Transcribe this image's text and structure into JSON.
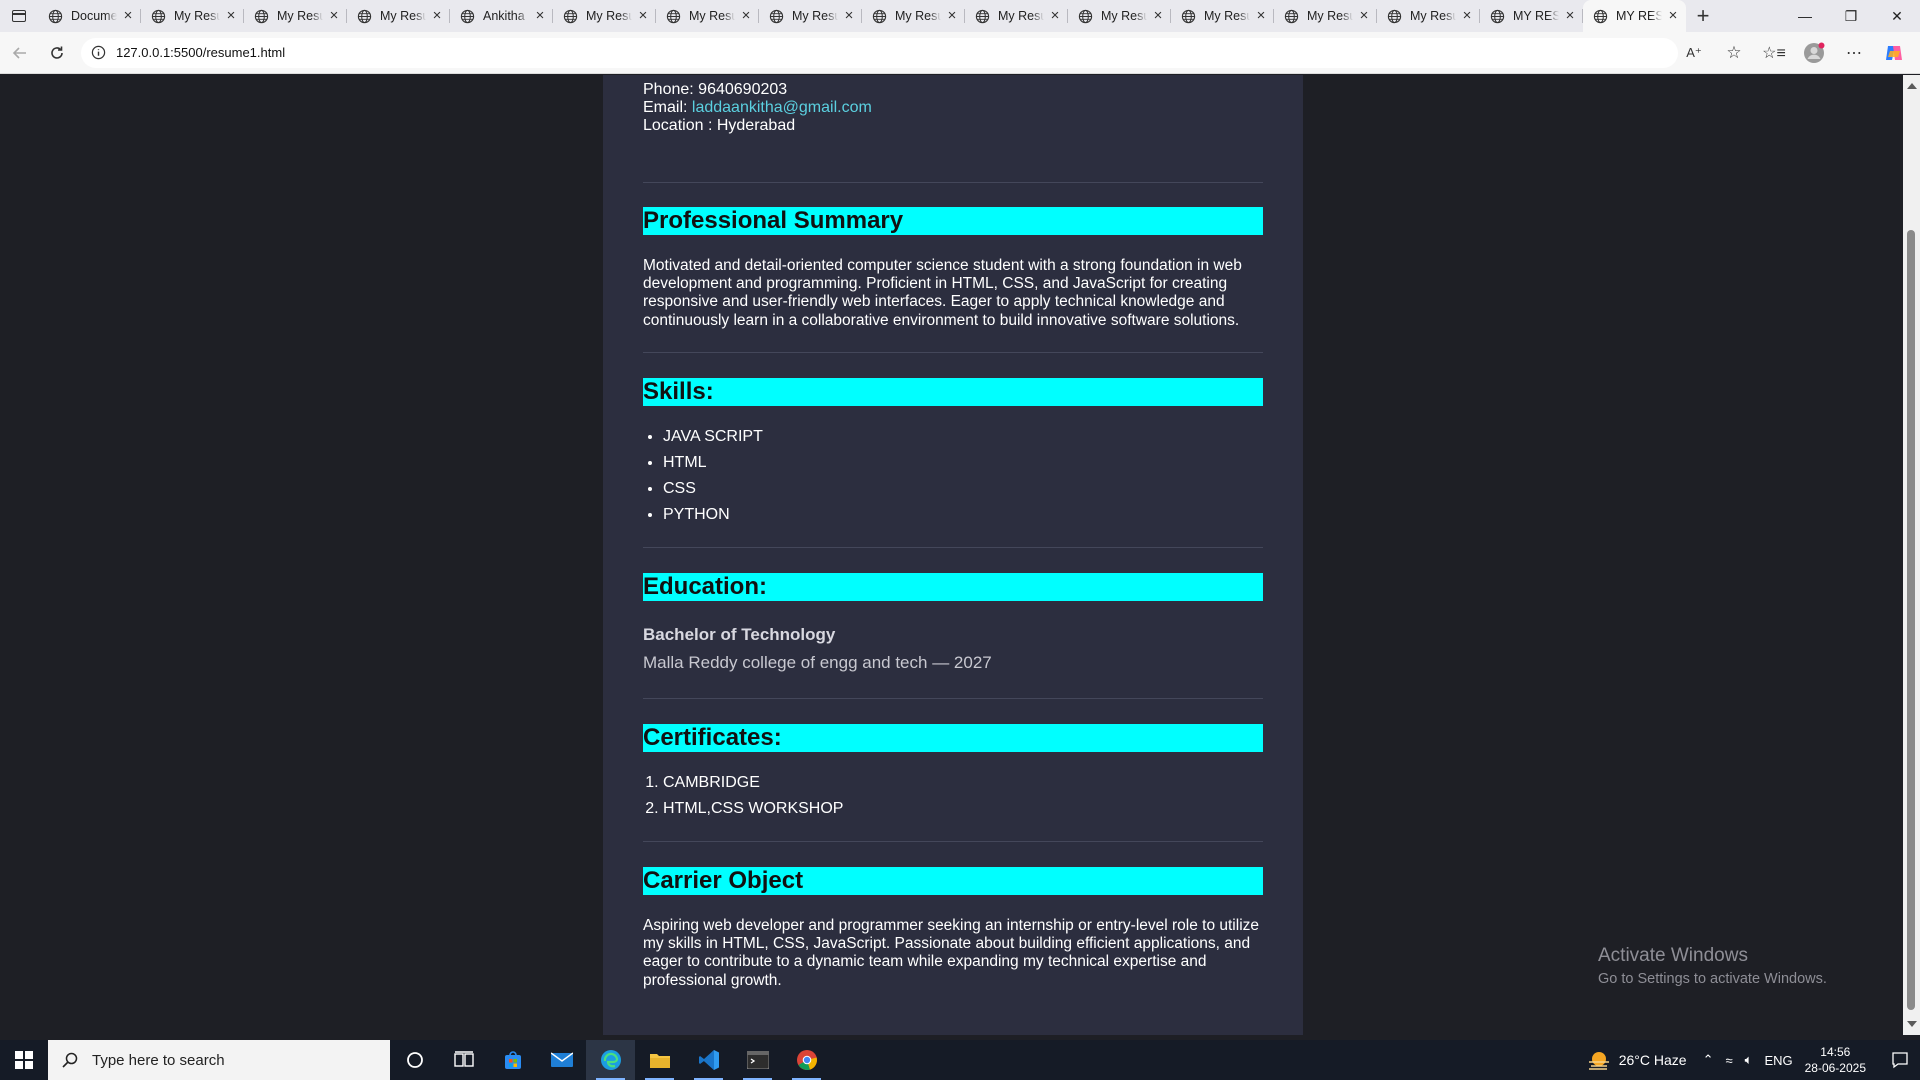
{
  "browser": {
    "tabs": [
      {
        "title": "Document",
        "active": false
      },
      {
        "title": "My Resume",
        "active": false
      },
      {
        "title": "My Resume",
        "active": false
      },
      {
        "title": "My Resume",
        "active": false
      },
      {
        "title": "Ankitha",
        "active": false
      },
      {
        "title": "My Resume",
        "active": false
      },
      {
        "title": "My Resume",
        "active": false
      },
      {
        "title": "My Resume",
        "active": false
      },
      {
        "title": "My Resume",
        "active": false
      },
      {
        "title": "My Resume",
        "active": false
      },
      {
        "title": "My Resume",
        "active": false
      },
      {
        "title": "My Resume",
        "active": false
      },
      {
        "title": "My Resume",
        "active": false
      },
      {
        "title": "My Resume",
        "active": false
      },
      {
        "title": "MY RESUME",
        "active": false
      },
      {
        "title": "MY RESUME",
        "active": true
      }
    ],
    "url": "127.0.0.1:5500/resume1.html"
  },
  "resume": {
    "contact": {
      "phone_label": "Phone:",
      "phone_value": "9640690203",
      "email_label": "Email:",
      "email_value": "laddaankitha@gmail.com",
      "location_label": "Location :",
      "location_value": "Hyderabad"
    },
    "summary": {
      "heading": "Professional Summary",
      "text": "Motivated and detail-oriented computer science student with a strong foundation in web development and programming. Proficient in HTML, CSS, and JavaScript for creating responsive and user-friendly web interfaces. Eager to apply technical knowledge and continuously learn in a collaborative environment to build innovative software solutions."
    },
    "skills": {
      "heading": "Skills:",
      "items": [
        "JAVA SCRIPT",
        "HTML",
        "CSS",
        "PYTHON"
      ]
    },
    "education": {
      "heading": "Education:",
      "degree": "Bachelor of Technology",
      "college": "Malla Reddy college of engg and tech — 2027"
    },
    "certificates": {
      "heading": "Certificates:",
      "items": [
        "CAMBRIDGE",
        "HTML,CSS WORKSHOP"
      ]
    },
    "objective": {
      "heading": "Carrier Object",
      "text": "Aspiring web developer and programmer seeking an internship or entry-level role to utilize my skills in HTML, CSS, JavaScript. Passionate about building efficient applications, and eager to contribute to a dynamic team while expanding my technical expertise and professional growth."
    }
  },
  "watermark": {
    "line1": "Activate Windows",
    "line2": "Go to Settings to activate Windows."
  },
  "taskbar": {
    "search_placeholder": "Type here to search",
    "weather": "26°C  Haze",
    "language": "ENG",
    "time": "14:56",
    "date": "28-06-2025"
  }
}
